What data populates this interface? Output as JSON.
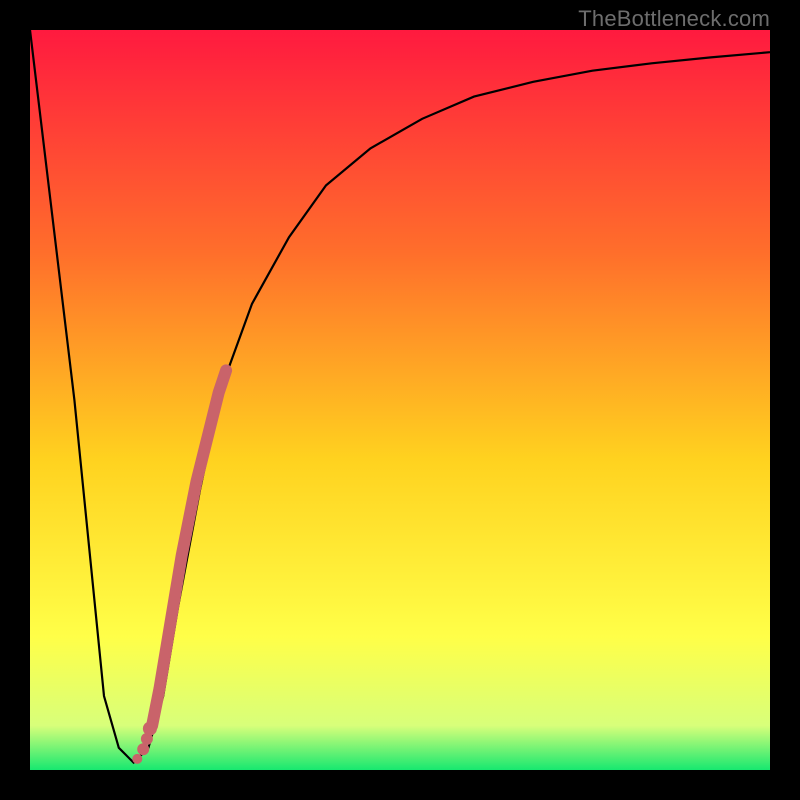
{
  "watermark": "TheBottleneck.com",
  "colors": {
    "frame": "#000000",
    "curve": "#000000",
    "markers": "#c9636a",
    "gradient_top": "#ff1a3f",
    "gradient_mid1": "#ff6e2b",
    "gradient_mid2": "#ffd21f",
    "gradient_mid3": "#ffff48",
    "gradient_bottom_band": "#d8ff7a",
    "gradient_bottom": "#17e870"
  },
  "chart_data": {
    "type": "line",
    "xlabel": "",
    "ylabel": "",
    "xlim": [
      0,
      100
    ],
    "ylim": [
      0,
      100
    ],
    "grid": false,
    "legend": false,
    "curve": {
      "x": [
        0,
        3,
        6,
        8,
        10,
        12,
        14,
        16,
        18,
        20,
        23,
        26,
        30,
        35,
        40,
        46,
        53,
        60,
        68,
        76,
        84,
        92,
        100
      ],
      "y": [
        100,
        75,
        50,
        30,
        10,
        3,
        1,
        3,
        10,
        22,
        38,
        52,
        63,
        72,
        79,
        84,
        88,
        91,
        93,
        94.5,
        95.5,
        96.3,
        97
      ]
    },
    "series": [
      {
        "name": "highlight-stroke",
        "x": [
          16.5,
          17.5,
          18.5,
          19.5,
          20.5,
          21.5,
          22.5,
          23.5,
          24.5,
          25.5,
          26.5
        ],
        "y": [
          6,
          11,
          17,
          23,
          29,
          34,
          39,
          43,
          47,
          51,
          54
        ]
      },
      {
        "name": "dots",
        "x": [
          14.5,
          15.3,
          15.8,
          16.2
        ],
        "y": [
          1.5,
          2.8,
          4.2,
          5.6
        ]
      }
    ]
  }
}
